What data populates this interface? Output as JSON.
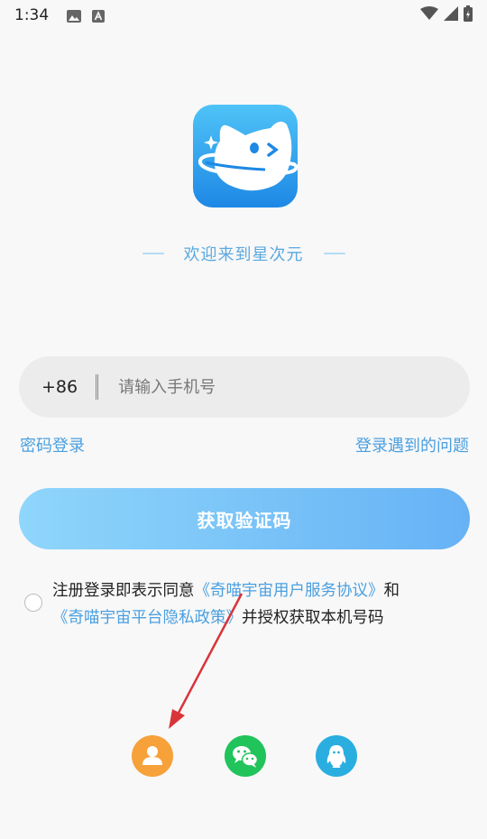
{
  "status_bar": {
    "time": "1:34",
    "icons": [
      "image-icon",
      "font-icon",
      "wifi-icon",
      "signal-icon",
      "battery-icon"
    ]
  },
  "welcome_text": "欢迎来到星次元",
  "phone": {
    "country_code": "+86",
    "placeholder": "请输入手机号",
    "value": ""
  },
  "links": {
    "password_login": "密码登录",
    "login_problem": "登录遇到的问题"
  },
  "get_code_button": "获取验证码",
  "agreement": {
    "prefix": "注册登录即表示同意",
    "user_agreement": "《奇喵宇宙用户服务协议》",
    "and": "和",
    "privacy_policy": "《奇喵宇宙平台隐私政策》",
    "suffix": "并授权获取本机号码",
    "checked": false
  },
  "social_logins": [
    {
      "name": "account-icon",
      "color": "#f7a13a"
    },
    {
      "name": "wechat-icon",
      "color": "#21c35b"
    },
    {
      "name": "qq-icon",
      "color": "#2aaee0"
    }
  ],
  "colors": {
    "accent": "#4a9fe0",
    "annotation_arrow": "#d9343a"
  }
}
